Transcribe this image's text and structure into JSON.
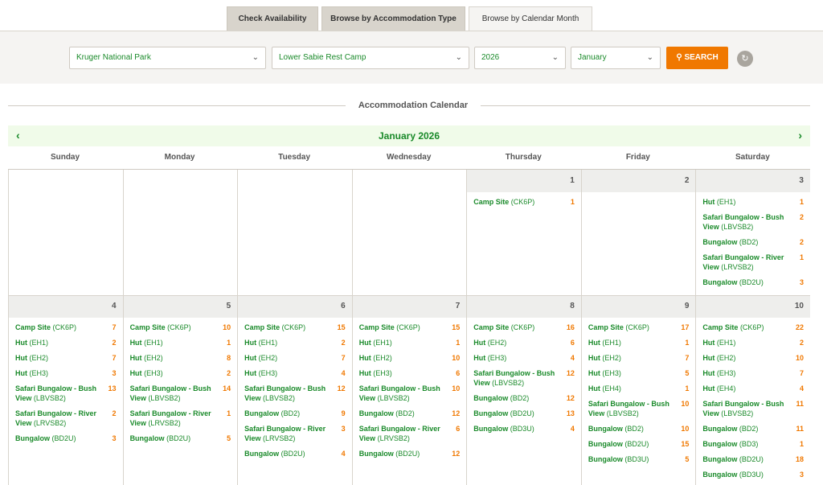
{
  "tabs": [
    "Check Availability",
    "Browse by Accommodation Type",
    "Browse by Calendar Month"
  ],
  "filters": {
    "park": "Kruger National Park",
    "camp": "Lower Sabie Rest Camp",
    "year": "2026",
    "month": "January",
    "search_label": "SEARCH"
  },
  "section_title": "Accommodation Calendar",
  "month_title": "January 2026",
  "weekdays": [
    "Sunday",
    "Monday",
    "Tuesday",
    "Wednesday",
    "Thursday",
    "Friday",
    "Saturday"
  ],
  "week1": [
    {
      "day": "",
      "entries": []
    },
    {
      "day": "",
      "entries": []
    },
    {
      "day": "",
      "entries": []
    },
    {
      "day": "",
      "entries": []
    },
    {
      "day": "1",
      "entries": [
        {
          "name": "Camp Site",
          "code": "(CK6P)",
          "count": "1"
        }
      ]
    },
    {
      "day": "2",
      "entries": []
    },
    {
      "day": "3",
      "entries": [
        {
          "name": "Hut",
          "code": "(EH1)",
          "count": "1"
        },
        {
          "name": "Safari Bungalow - Bush View",
          "code": "(LBVSB2)",
          "count": "2"
        },
        {
          "name": "Bungalow",
          "code": "(BD2)",
          "count": "2"
        },
        {
          "name": "Safari Bungalow - River View",
          "code": "(LRVSB2)",
          "count": "1"
        },
        {
          "name": "Bungalow",
          "code": "(BD2U)",
          "count": "3"
        }
      ]
    }
  ],
  "week2": [
    {
      "day": "4",
      "entries": [
        {
          "name": "Camp Site",
          "code": "(CK6P)",
          "count": "7"
        },
        {
          "name": "Hut",
          "code": "(EH1)",
          "count": "2"
        },
        {
          "name": "Hut",
          "code": "(EH2)",
          "count": "7"
        },
        {
          "name": "Hut",
          "code": "(EH3)",
          "count": "3"
        },
        {
          "name": "Safari Bungalow - Bush View",
          "code": "(LBVSB2)",
          "count": "13"
        },
        {
          "name": "Safari Bungalow - River View",
          "code": "(LRVSB2)",
          "count": "2"
        },
        {
          "name": "Bungalow",
          "code": "(BD2U)",
          "count": "3"
        }
      ]
    },
    {
      "day": "5",
      "entries": [
        {
          "name": "Camp Site",
          "code": "(CK6P)",
          "count": "10"
        },
        {
          "name": "Hut",
          "code": "(EH1)",
          "count": "1"
        },
        {
          "name": "Hut",
          "code": "(EH2)",
          "count": "8"
        },
        {
          "name": "Hut",
          "code": "(EH3)",
          "count": "2"
        },
        {
          "name": "Safari Bungalow - Bush View",
          "code": "(LBVSB2)",
          "count": "14"
        },
        {
          "name": "Safari Bungalow - River View",
          "code": "(LRVSB2)",
          "count": "1"
        },
        {
          "name": "Bungalow",
          "code": "(BD2U)",
          "count": "5"
        }
      ]
    },
    {
      "day": "6",
      "entries": [
        {
          "name": "Camp Site",
          "code": "(CK6P)",
          "count": "15"
        },
        {
          "name": "Hut",
          "code": "(EH1)",
          "count": "2"
        },
        {
          "name": "Hut",
          "code": "(EH2)",
          "count": "7"
        },
        {
          "name": "Hut",
          "code": "(EH3)",
          "count": "4"
        },
        {
          "name": "Safari Bungalow - Bush View",
          "code": "(LBVSB2)",
          "count": "12"
        },
        {
          "name": "Bungalow",
          "code": "(BD2)",
          "count": "9"
        },
        {
          "name": "Safari Bungalow - River View",
          "code": "(LRVSB2)",
          "count": "3"
        },
        {
          "name": "Bungalow",
          "code": "(BD2U)",
          "count": "4"
        }
      ]
    },
    {
      "day": "7",
      "entries": [
        {
          "name": "Camp Site",
          "code": "(CK6P)",
          "count": "15"
        },
        {
          "name": "Hut",
          "code": "(EH1)",
          "count": "1"
        },
        {
          "name": "Hut",
          "code": "(EH2)",
          "count": "10"
        },
        {
          "name": "Hut",
          "code": "(EH3)",
          "count": "6"
        },
        {
          "name": "Safari Bungalow - Bush View",
          "code": "(LBVSB2)",
          "count": "10"
        },
        {
          "name": "Bungalow",
          "code": "(BD2)",
          "count": "12"
        },
        {
          "name": "Safari Bungalow - River View",
          "code": "(LRVSB2)",
          "count": "6"
        },
        {
          "name": "Bungalow",
          "code": "(BD2U)",
          "count": "12"
        }
      ]
    },
    {
      "day": "8",
      "entries": [
        {
          "name": "Camp Site",
          "code": "(CK6P)",
          "count": "16"
        },
        {
          "name": "Hut",
          "code": "(EH2)",
          "count": "6"
        },
        {
          "name": "Hut",
          "code": "(EH3)",
          "count": "4"
        },
        {
          "name": "Safari Bungalow - Bush View",
          "code": "(LBVSB2)",
          "count": "12"
        },
        {
          "name": "Bungalow",
          "code": "(BD2)",
          "count": "12"
        },
        {
          "name": "Bungalow",
          "code": "(BD2U)",
          "count": "13"
        },
        {
          "name": "Bungalow",
          "code": "(BD3U)",
          "count": "4"
        }
      ]
    },
    {
      "day": "9",
      "entries": [
        {
          "name": "Camp Site",
          "code": "(CK6P)",
          "count": "17"
        },
        {
          "name": "Hut",
          "code": "(EH1)",
          "count": "1"
        },
        {
          "name": "Hut",
          "code": "(EH2)",
          "count": "7"
        },
        {
          "name": "Hut",
          "code": "(EH3)",
          "count": "5"
        },
        {
          "name": "Hut",
          "code": "(EH4)",
          "count": "1"
        },
        {
          "name": "Safari Bungalow - Bush View",
          "code": "(LBVSB2)",
          "count": "10"
        },
        {
          "name": "Bungalow",
          "code": "(BD2)",
          "count": "10"
        },
        {
          "name": "Bungalow",
          "code": "(BD2U)",
          "count": "15"
        },
        {
          "name": "Bungalow",
          "code": "(BD3U)",
          "count": "5"
        }
      ]
    },
    {
      "day": "10",
      "entries": [
        {
          "name": "Camp Site",
          "code": "(CK6P)",
          "count": "22"
        },
        {
          "name": "Hut",
          "code": "(EH1)",
          "count": "2"
        },
        {
          "name": "Hut",
          "code": "(EH2)",
          "count": "10"
        },
        {
          "name": "Hut",
          "code": "(EH3)",
          "count": "7"
        },
        {
          "name": "Hut",
          "code": "(EH4)",
          "count": "4"
        },
        {
          "name": "Safari Bungalow - Bush View",
          "code": "(LBVSB2)",
          "count": "11"
        },
        {
          "name": "Bungalow",
          "code": "(BD2)",
          "count": "11"
        },
        {
          "name": "Bungalow",
          "code": "(BD3)",
          "count": "1"
        },
        {
          "name": "Bungalow",
          "code": "(BD2U)",
          "count": "18"
        },
        {
          "name": "Bungalow",
          "code": "(BD3U)",
          "count": "3"
        }
      ]
    }
  ]
}
